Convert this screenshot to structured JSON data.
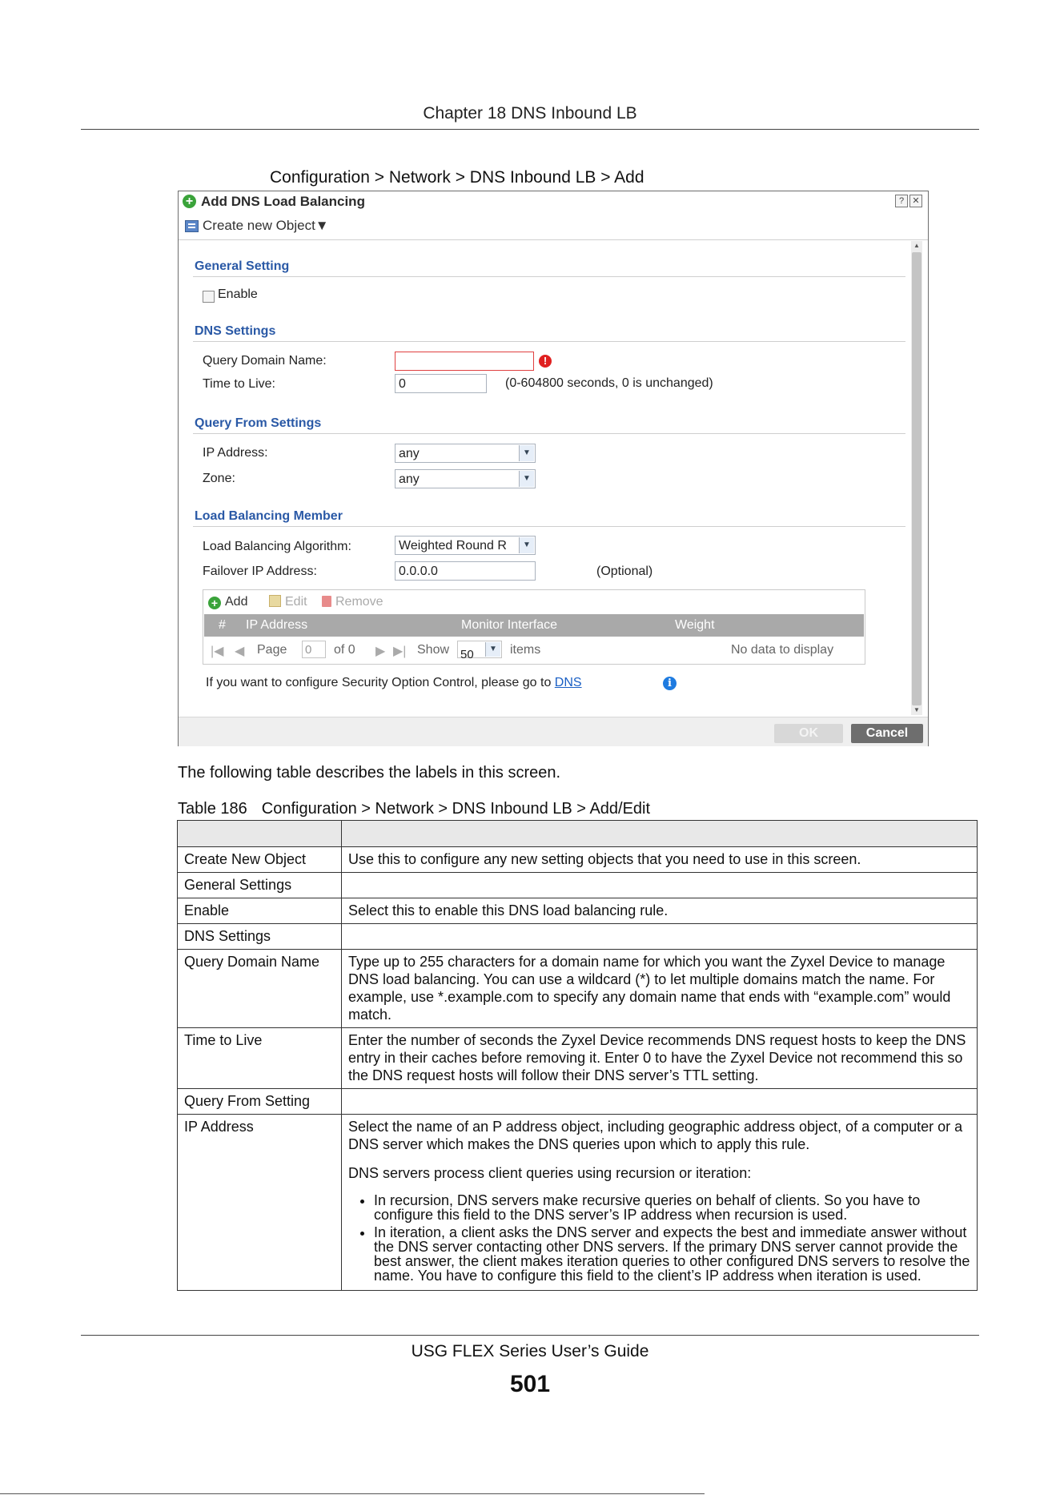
{
  "page_header": {
    "chapter_title": "Chapter 18 DNS Inbound LB"
  },
  "figure": {
    "caption": "Configuration > Network > DNS Inbound LB > Add"
  },
  "dialog": {
    "title": "Add DNS Load Balancing",
    "toolbar": {
      "create_object_label": "Create new Object▼"
    },
    "window_buttons": {
      "help": "?",
      "close": "✕"
    },
    "general": {
      "heading": "General Setting",
      "enable_label": "Enable",
      "enable_checked": false
    },
    "dns": {
      "heading": "DNS Settings",
      "query_domain_label": "Query Domain Name:",
      "query_domain_value": "",
      "error_glyph": "!",
      "ttl_label": "Time to Live:",
      "ttl_value": "0",
      "ttl_hint": "(0-604800 seconds, 0 is unchanged)"
    },
    "query_from": {
      "heading": "Query From Settings",
      "ip_label": "IP Address:",
      "ip_value": "any",
      "zone_label": "Zone:",
      "zone_value": "any"
    },
    "member": {
      "heading": "Load Balancing Member",
      "algorithm_label": "Load Balancing Algorithm:",
      "algorithm_value": "Weighted Round R",
      "failover_label": "Failover IP Address:",
      "failover_value": "0.0.0.0",
      "failover_hint": "(Optional)",
      "buttons": {
        "add": "Add",
        "edit": "Edit",
        "remove": "Remove"
      },
      "columns": {
        "index": "#",
        "ip": "IP Address",
        "monitor": "Monitor Interface",
        "weight": "Weight"
      },
      "pager": {
        "page_label": "Page",
        "page_value": "0",
        "of_label": "of 0",
        "show_label": "Show",
        "show_value": "50",
        "items_label": "items",
        "empty_text": "No data to display"
      }
    },
    "note": {
      "text": "If you want to configure Security Option Control, please go to ",
      "link": "DNS"
    },
    "footer": {
      "ok": "OK",
      "cancel": "Cancel"
    }
  },
  "intro_text": "The following table describes the labels in this screen.",
  "table": {
    "caption_number": "Table 186",
    "caption_text": "Configuration > Network > DNS Inbound LB > Add/Edit",
    "header": {
      "label": "",
      "description": ""
    },
    "rows": [
      {
        "label": "Create New Object",
        "description": "Use this to configure any new setting objects that you need to use in this screen."
      },
      {
        "label": "General Settings",
        "description": ""
      },
      {
        "label": "Enable",
        "description": "Select this to enable this DNS load balancing rule."
      },
      {
        "label": "DNS Settings",
        "description": ""
      },
      {
        "label": "Query Domain Name",
        "description": "Type up to 255 characters for a domain name for which you want the Zyxel Device to manage DNS load balancing. You can use a wildcard (*) to let multiple domains match the name. For example, use *.example.com to specify any domain name that ends with “example.com” would match."
      },
      {
        "label": "Time to Live",
        "description": "Enter the number of seconds the Zyxel Device recommends DNS request hosts to keep the DNS entry in their caches before removing it. Enter 0 to have the Zyxel Device not recommend this so the DNS request hosts will follow their DNS server’s TTL setting."
      },
      {
        "label": "Query From Setting",
        "description": ""
      },
      {
        "label": "IP Address",
        "description": "Select the name of an P address object, including geographic address object, of a computer or a DNS server which makes the DNS queries upon which to apply this rule.",
        "paragraph2": "DNS servers process client queries using recursion or iteration:",
        "bullets": [
          "In recursion, DNS servers make recursive queries on behalf of clients. So you have to configure this field to the DNS server’s IP address when recursion is used.",
          "In iteration, a client asks the DNS server and expects the best and immediate answer without the DNS server contacting other DNS servers. If the primary DNS server cannot provide the best answer, the client makes iteration queries to other configured DNS servers to resolve the name. You have to configure this field to the client’s IP address when iteration is used."
        ]
      }
    ]
  },
  "page_footer": {
    "guide_title": "USG FLEX Series User’s Guide",
    "page_number": "501"
  }
}
